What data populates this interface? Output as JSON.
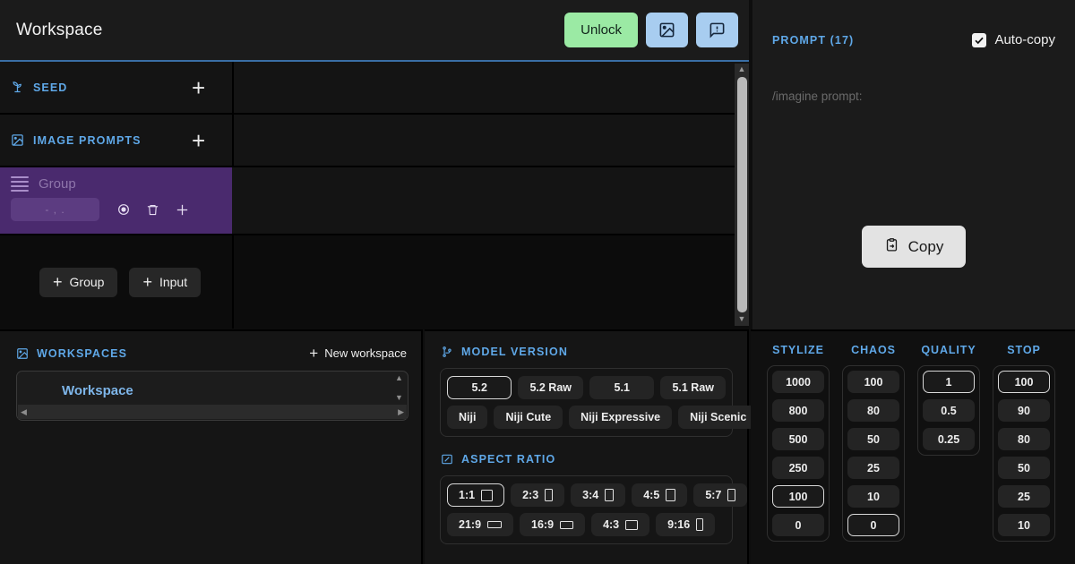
{
  "header": {
    "title": "Workspace",
    "unlock_label": "Unlock",
    "image_button_icon": "image-edit-icon",
    "feedback_button_icon": "message-alert-icon",
    "accent_unlock": "#9beaa4",
    "accent_icon_button": "#a8cdf0",
    "accent_rule": "#3a6ea5"
  },
  "sections": {
    "seed": {
      "label": "SEED",
      "icon": "sprout-icon",
      "add": "+"
    },
    "image_prompts": {
      "label": "IMAGE PROMPTS",
      "icon": "image-icon",
      "add": "+"
    }
  },
  "group": {
    "name": "Group",
    "field_value": "-  ,  .",
    "eye_icon": "eye-icon",
    "delete_icon": "trash-icon",
    "add_icon": "plus-icon",
    "background": "#4a2a6e"
  },
  "add_buttons": [
    {
      "label": "Group",
      "plus": "+"
    },
    {
      "label": "Input",
      "plus": "+"
    }
  ],
  "prompt": {
    "title": "PROMPT (17)",
    "autocopy_label": "Auto-copy",
    "autocopy_checked": true,
    "placeholder": "/imagine prompt:",
    "copy_label": "Copy",
    "copy_icon": "clipboard-icon",
    "accent": "#5fa8e8"
  },
  "workspaces": {
    "title": "WORKSPACES",
    "icon": "image-icon",
    "new_label": "New workspace",
    "new_plus": "+",
    "items": [
      {
        "label": "Workspace",
        "selected": true
      }
    ],
    "scroll_up": "▲",
    "scroll_down": "▼",
    "scroll_left": "◀",
    "scroll_right": "▶"
  },
  "model_version": {
    "title": "MODEL VERSION",
    "icon": "git-branch-icon",
    "rows": [
      [
        {
          "label": "5.2",
          "selected": true
        },
        {
          "label": "5.2 Raw",
          "selected": false
        },
        {
          "label": "5.1",
          "selected": false
        },
        {
          "label": "5.1 Raw",
          "selected": false
        }
      ],
      [
        {
          "label": "Niji",
          "selected": false
        },
        {
          "label": "Niji Cute",
          "selected": false
        },
        {
          "label": "Niji Expressive",
          "selected": false
        },
        {
          "label": "Niji Scenic",
          "selected": false
        }
      ]
    ]
  },
  "aspect_ratio": {
    "title": "ASPECT RATIO",
    "icon": "aspect-icon",
    "rows": [
      [
        {
          "label": "1:1",
          "w": 13,
          "h": 13,
          "selected": true
        },
        {
          "label": "2:3",
          "w": 9,
          "h": 14,
          "selected": false
        },
        {
          "label": "3:4",
          "w": 10,
          "h": 14,
          "selected": false
        },
        {
          "label": "4:5",
          "w": 11,
          "h": 14,
          "selected": false
        },
        {
          "label": "5:7",
          "w": 9,
          "h": 14,
          "selected": false
        }
      ],
      [
        {
          "label": "21:9",
          "w": 16,
          "h": 8,
          "selected": false
        },
        {
          "label": "16:9",
          "w": 15,
          "h": 9,
          "selected": false
        },
        {
          "label": "4:3",
          "w": 14,
          "h": 11,
          "selected": false
        },
        {
          "label": "9:16",
          "w": 8,
          "h": 14,
          "selected": false
        }
      ]
    ]
  },
  "params": [
    {
      "title": "STYLIZE",
      "options": [
        {
          "label": "1000",
          "selected": false
        },
        {
          "label": "800",
          "selected": false
        },
        {
          "label": "500",
          "selected": false
        },
        {
          "label": "250",
          "selected": false
        },
        {
          "label": "100",
          "selected": true
        },
        {
          "label": "0",
          "selected": false
        }
      ]
    },
    {
      "title": "CHAOS",
      "options": [
        {
          "label": "100",
          "selected": false
        },
        {
          "label": "80",
          "selected": false
        },
        {
          "label": "50",
          "selected": false
        },
        {
          "label": "25",
          "selected": false
        },
        {
          "label": "10",
          "selected": false
        },
        {
          "label": "0",
          "selected": true
        }
      ]
    },
    {
      "title": "QUALITY",
      "options": [
        {
          "label": "1",
          "selected": true
        },
        {
          "label": "0.5",
          "selected": false
        },
        {
          "label": "0.25",
          "selected": false
        }
      ]
    },
    {
      "title": "STOP",
      "options": [
        {
          "label": "100",
          "selected": true
        },
        {
          "label": "90",
          "selected": false
        },
        {
          "label": "80",
          "selected": false
        },
        {
          "label": "50",
          "selected": false
        },
        {
          "label": "25",
          "selected": false
        },
        {
          "label": "10",
          "selected": false
        }
      ]
    }
  ]
}
